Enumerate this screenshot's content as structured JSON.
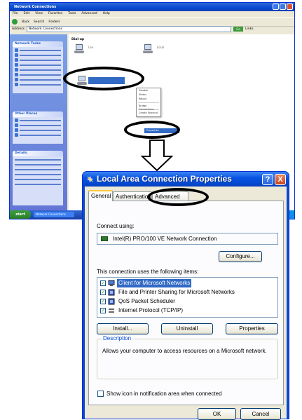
{
  "background_window": {
    "title": "Network Connections",
    "menu": [
      "File",
      "Edit",
      "View",
      "Favorites",
      "Tools",
      "Advanced",
      "Help"
    ],
    "toolbar": [
      "Back",
      "Search",
      "Folders"
    ],
    "address_label": "Address",
    "address": "Network Connections",
    "go": "Go",
    "links": "Links",
    "group_header": "Dial-up",
    "connection1": "Lan",
    "connection2": "Local",
    "taskpane_headers": [
      "Network Tasks",
      "Other Places",
      "Details"
    ],
    "context_menu": [
      "Disable",
      "Status",
      "Repair",
      "Bridge Connections",
      "Create Shortcut",
      "Delete",
      "Rename"
    ],
    "context_menu_properties": "Properties",
    "start": "start",
    "taskbar_task": "Network Connections"
  },
  "dialog": {
    "title": "Local Area Connection Properties",
    "help_glyph": "?",
    "close_glyph": "X",
    "tabs": {
      "general": "General",
      "authentication": "Authentication",
      "advanced": "Advanced"
    },
    "connect_using_label": "Connect using:",
    "adapter_name": "Intel(R) PRO/100 VE Network Connection",
    "configure_button": "Configure...",
    "components_label": "This connection uses the following items:",
    "items": [
      {
        "label": "Client for Microsoft Networks",
        "checked": true,
        "selected": true
      },
      {
        "label": "File and Printer Sharing for Microsoft Networks",
        "checked": true,
        "selected": false
      },
      {
        "label": "QoS Packet Scheduler",
        "checked": true,
        "selected": false
      },
      {
        "label": "Internet Protocol (TCP/IP)",
        "checked": true,
        "selected": false
      }
    ],
    "install_button": "Install...",
    "uninstall_button": "Uninstall",
    "properties_button": "Properties",
    "description_legend": "Description",
    "description_text": "Allows your computer to access resources on a Microsoft network.",
    "show_icon_label": "Show icon in notification area when connected",
    "ok_button": "OK",
    "cancel_button": "Cancel"
  },
  "colors": {
    "xp_title_blue": "#0a4ad0",
    "selection_blue": "#316ac5",
    "dialog_face": "#ece9d8",
    "annotation": "#000000"
  }
}
